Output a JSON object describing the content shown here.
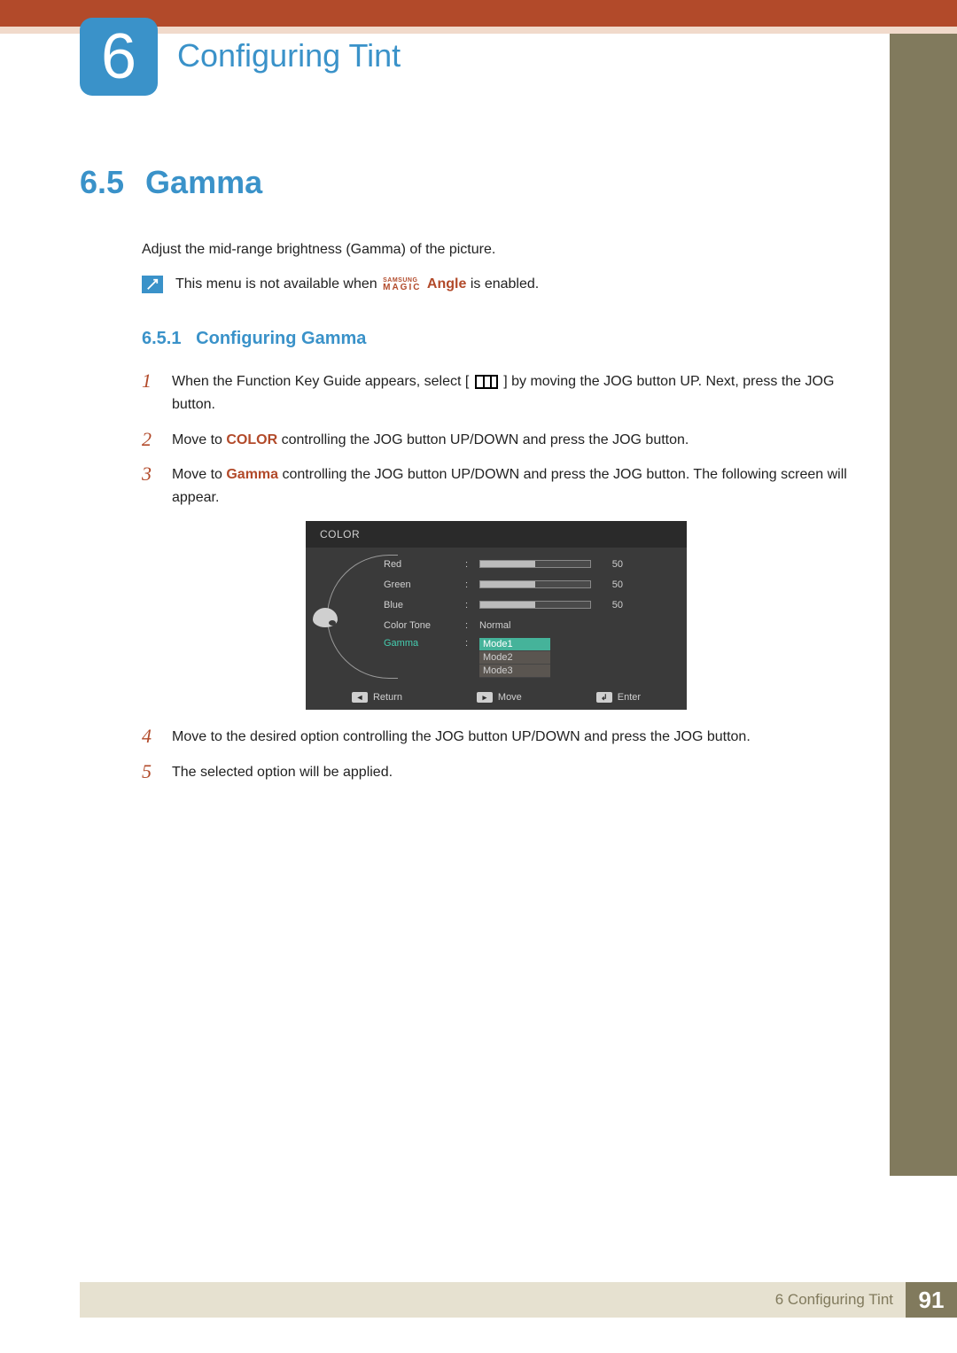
{
  "chapter": {
    "number": "6",
    "title": "Configuring Tint"
  },
  "section": {
    "number": "6.5",
    "title": "Gamma"
  },
  "intro": "Adjust the mid-range brightness (Gamma) of the picture.",
  "note": {
    "prefix": "This menu is not available when ",
    "magic_small": "SAMSUNG",
    "magic_big": "MAGIC",
    "angle": "Angle",
    "suffix": " is enabled."
  },
  "subsection": {
    "number": "6.5.1",
    "title": "Configuring Gamma"
  },
  "steps": {
    "s1": {
      "n": "1",
      "a": "When the Function Key Guide appears, select [",
      "b": "] by moving the JOG button UP. Next, press the JOG button."
    },
    "s2": {
      "n": "2",
      "a": "Move to ",
      "kw": "COLOR",
      "b": " controlling the JOG button UP/DOWN and press the JOG button."
    },
    "s3": {
      "n": "3",
      "a": "Move to ",
      "kw": "Gamma",
      "b": " controlling the JOG button UP/DOWN and press the JOG button. The following screen will appear."
    },
    "s4": {
      "n": "4",
      "a": "Move to the desired option controlling the JOG button UP/DOWN and press the JOG button."
    },
    "s5": {
      "n": "5",
      "a": "The selected option will be applied."
    }
  },
  "osd": {
    "header": "COLOR",
    "rows": {
      "red": {
        "label": "Red",
        "value": "50",
        "fill": 50
      },
      "green": {
        "label": "Green",
        "value": "50",
        "fill": 50
      },
      "blue": {
        "label": "Blue",
        "value": "50",
        "fill": 50
      },
      "tone": {
        "label": "Color Tone",
        "value": "Normal"
      },
      "gamma": {
        "label": "Gamma"
      }
    },
    "modes": {
      "m1": "Mode1",
      "m2": "Mode2",
      "m3": "Mode3"
    },
    "footer": {
      "return": "Return",
      "move": "Move",
      "enter": "Enter"
    }
  },
  "footer": {
    "text": "6 Configuring Tint",
    "page": "91"
  }
}
